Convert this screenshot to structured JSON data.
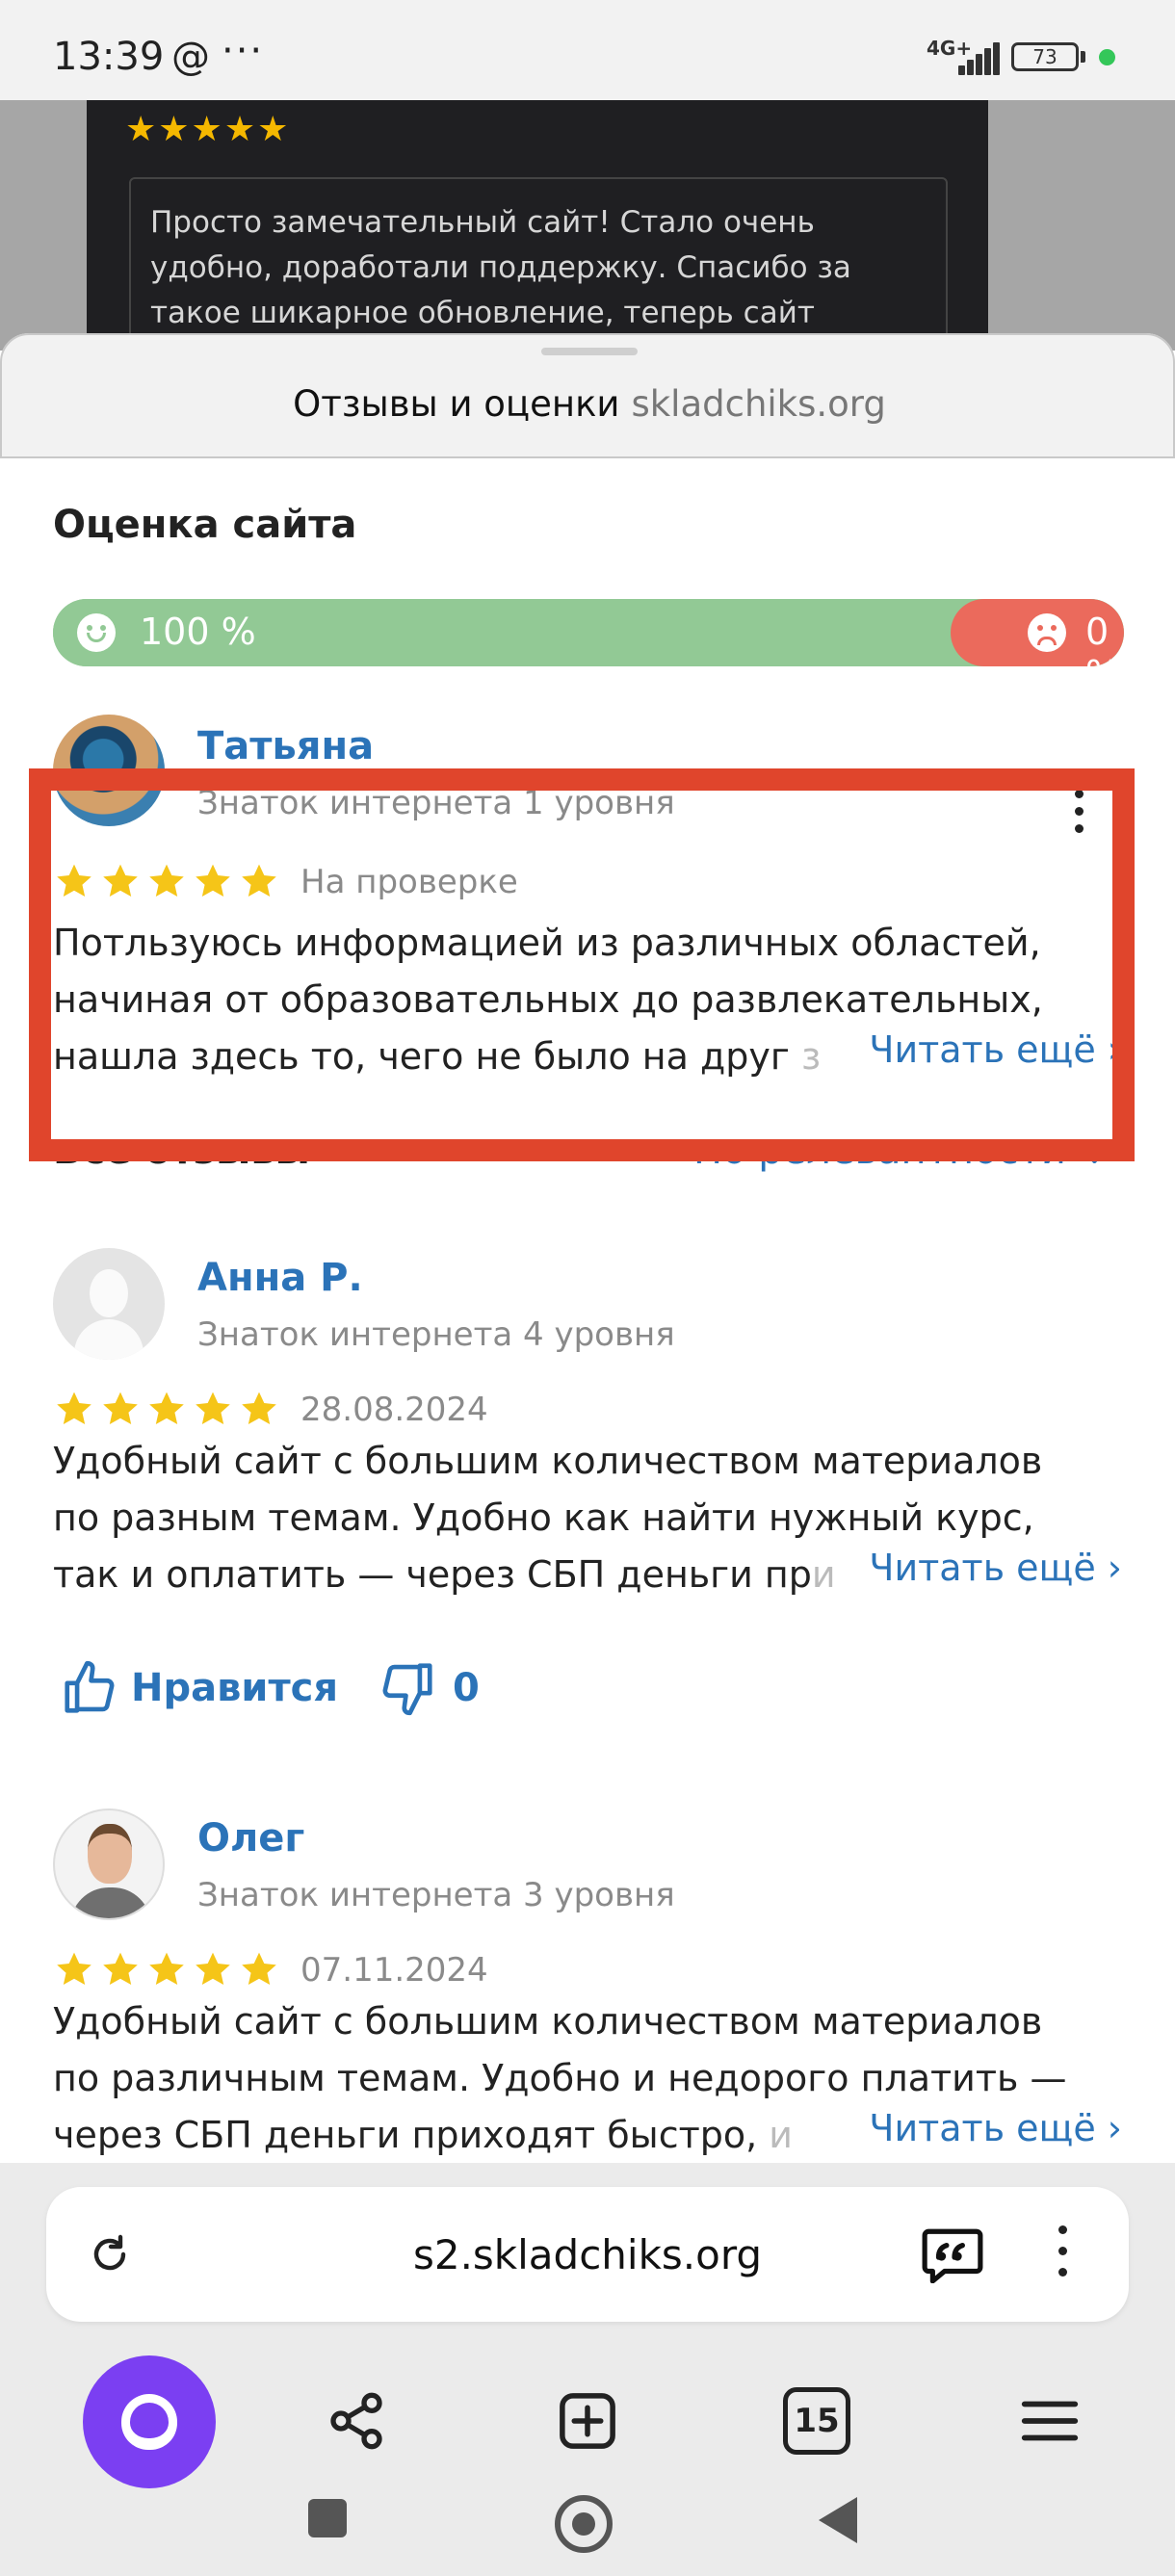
{
  "status_bar": {
    "time": "13:39",
    "at_symbol": "@",
    "dots": "···",
    "network": "4G+",
    "battery": "73"
  },
  "background_page": {
    "stars": "★★★★★",
    "review_text": "Просто замечательный сайт! Стало очень удобно, доработали поддержку. Спасибо за такое шикарное обновление, теперь сайт"
  },
  "sheet": {
    "title": "Отзывы и оценки",
    "domain": "skladchiks.org",
    "rating_section_title": "Оценка сайта",
    "rating": {
      "positive_pct": "100 %",
      "negative_pct": "0 %",
      "positive_fraction": 1.0,
      "positive_color": "#92c995",
      "negative_color": "#eb6a5c"
    },
    "all_reviews_title": "Все отзывы",
    "sort_label": "По релевантности ⌄",
    "read_more": "Читать ещё ›",
    "accent_color": "#2b73b8",
    "highlight_color": "#e0452c",
    "reviews": [
      {
        "author": "Татьяна",
        "level": "Знаток интернета 1 уровня",
        "rating": 5,
        "status": "На проверке",
        "lines": [
          "Потльзуюсь информацией из различных областей,",
          "начиная от образовательных до развлекательных,",
          "нашла здесь то, чего не было на друг"
        ],
        "faded": "з"
      },
      {
        "author": "Анна Р.",
        "level": "Знаток интернета 4 уровня",
        "rating": 5,
        "date": "28.08.2024",
        "lines": [
          "Удобный сайт с большим количеством материалов",
          "по разным темам. Удобно как найти нужный курс,",
          "так и оплатить — через СБП деньги пр"
        ],
        "faded": "и",
        "like_label": "Нравится",
        "dislike_count": "0"
      },
      {
        "author": "Олег",
        "level": "Знаток интернета 3 уровня",
        "rating": 5,
        "date": "07.11.2024",
        "lines": [
          "Удобный сайт с большим количеством материалов",
          "по различным темам. Удобно и недорого платить —",
          "через СБП деньги приходят быстро,"
        ],
        "faded": "и"
      }
    ]
  },
  "browser": {
    "url": "s2.skladchiks.org",
    "tabs_count": "15",
    "alice_color": "#7b3ff2"
  }
}
